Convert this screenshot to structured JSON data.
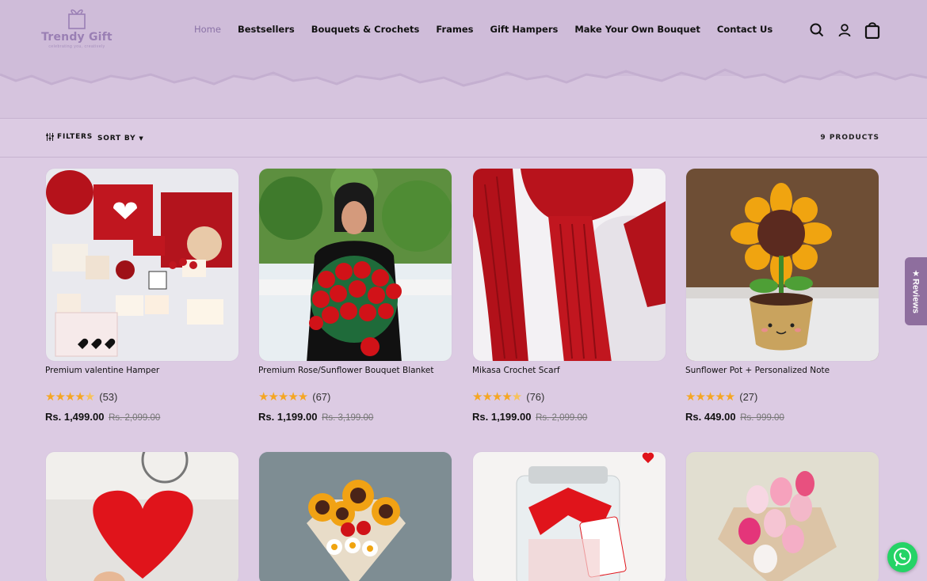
{
  "brand": {
    "name": "Trendy Gift",
    "tagline": "celebrating you, creatively"
  },
  "nav": {
    "items": [
      "Home",
      "Bestsellers",
      "Bouquets & Crochets",
      "Frames",
      "Gift Hampers",
      "Make Your Own Bouquet",
      "Contact Us"
    ],
    "active": "Home"
  },
  "header_icons": [
    "search-icon",
    "account-icon",
    "cart-icon"
  ],
  "toolbar": {
    "filters_label": "FILTERS",
    "sort_label": "SORT BY",
    "count_label": "9 PRODUCTS"
  },
  "products": [
    {
      "title": "Premium valentine Hamper",
      "rating_count": "(53)",
      "price": "Rs. 1,499.00",
      "old_price": "Rs. 2,099.00",
      "stars": 4.5
    },
    {
      "title": "Premium Rose/Sunflower Bouquet Blanket",
      "rating_count": "(67)",
      "price": "Rs. 1,199.00",
      "old_price": "Rs. 3,199.00",
      "stars": 5
    },
    {
      "title": "Mikasa Crochet Scarf",
      "rating_count": "(76)",
      "price": "Rs. 1,199.00",
      "old_price": "Rs. 2,099.00",
      "stars": 4.5
    },
    {
      "title": "Sunflower Pot + Personalized Note",
      "rating_count": "(27)",
      "price": "Rs. 449.00",
      "old_price": "Rs. 999.00",
      "stars": 5
    }
  ],
  "reviews_tab": "★Reviews",
  "colors": {
    "accent": "#8a72a6",
    "background": "#dccbe3",
    "header": "#cfbcd9",
    "star": "#f5a623"
  }
}
